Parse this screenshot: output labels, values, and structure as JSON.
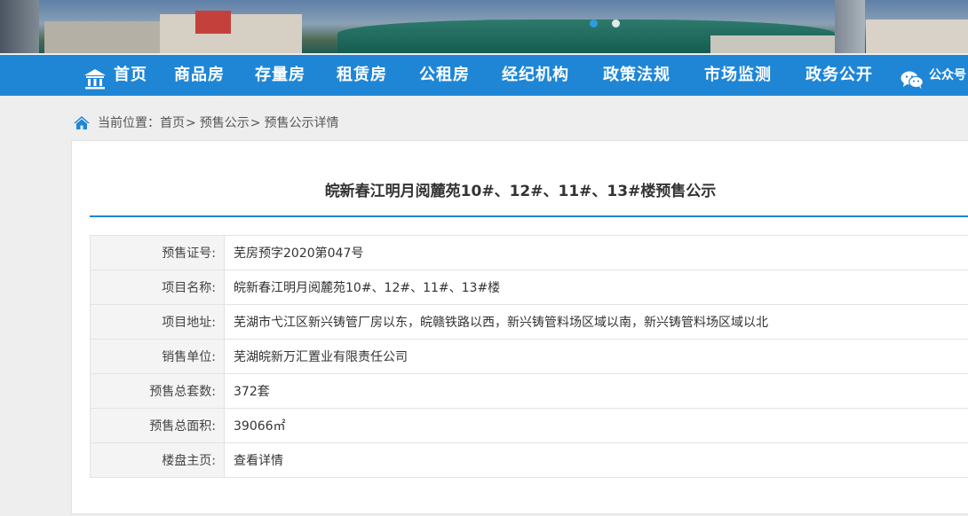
{
  "banner": {
    "slides": 2,
    "active_slide": 1
  },
  "nav": {
    "items": [
      {
        "label": "首页"
      },
      {
        "label": "商品房"
      },
      {
        "label": "存量房"
      },
      {
        "label": "租赁房"
      },
      {
        "label": "公租房"
      },
      {
        "label": "经纪机构"
      },
      {
        "label": "政策法规"
      },
      {
        "label": "市场监测"
      },
      {
        "label": "政务公开"
      },
      {
        "label": "公众号"
      }
    ]
  },
  "breadcrumb": {
    "prefix": "当前位置：",
    "items": [
      "首页",
      "预售公示",
      "预售公示详情"
    ],
    "separator": ">"
  },
  "detail": {
    "title": "皖新春江明月阅麓苑10#、12#、11#、13#楼预售公示",
    "rows": [
      {
        "label": "预售证号:",
        "value": "芜房预字2020第047号"
      },
      {
        "label": "项目名称:",
        "value": "皖新春江明月阅麓苑10#、12#、11#、13#楼"
      },
      {
        "label": "项目地址:",
        "value": "芜湖市弋江区新兴铸管厂房以东，皖赣铁路以西，新兴铸管料场区域以南，新兴铸管料场区域以北"
      },
      {
        "label": "销售单位:",
        "value": "芜湖皖新万汇置业有限责任公司"
      },
      {
        "label": "预售总套数:",
        "value": "372套"
      },
      {
        "label": "预售总面积:",
        "value": "39066㎡"
      },
      {
        "label": "楼盘主页:",
        "value": "查看详情"
      }
    ]
  },
  "colors": {
    "nav_bg": "#1f86d6",
    "accent": "#1f86d6",
    "page_bg": "#eeeeee"
  }
}
